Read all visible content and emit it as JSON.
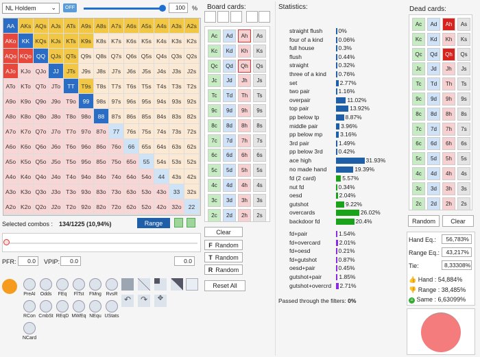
{
  "top": {
    "game": "NL Holdem",
    "toggle": "OFF",
    "percent": "100",
    "percent_unit": "%"
  },
  "range_grid": [
    [
      "AA",
      "AKs",
      "AQs",
      "AJs",
      "ATs",
      "A9s",
      "A8s",
      "A7s",
      "A6s",
      "A5s",
      "A4s",
      "A3s",
      "A2s"
    ],
    [
      "AKo",
      "KK",
      "KQs",
      "KJs",
      "KTs",
      "K9s",
      "K8s",
      "K7s",
      "K6s",
      "K5s",
      "K4s",
      "K3s",
      "K2s"
    ],
    [
      "AQo",
      "KQo",
      "QQ",
      "QJs",
      "QTs",
      "Q9s",
      "Q8s",
      "Q7s",
      "Q6s",
      "Q5s",
      "Q4s",
      "Q3s",
      "Q2s"
    ],
    [
      "AJo",
      "KJo",
      "QJo",
      "JJ",
      "JTs",
      "J9s",
      "J8s",
      "J7s",
      "J6s",
      "J5s",
      "J4s",
      "J3s",
      "J2s"
    ],
    [
      "ATo",
      "KTo",
      "QTo",
      "JTo",
      "TT",
      "T9s",
      "T8s",
      "T7s",
      "T6s",
      "T5s",
      "T4s",
      "T3s",
      "T2s"
    ],
    [
      "A9o",
      "K9o",
      "Q9o",
      "J9o",
      "T9o",
      "99",
      "98s",
      "97s",
      "96s",
      "95s",
      "94s",
      "93s",
      "92s"
    ],
    [
      "A8o",
      "K8o",
      "Q8o",
      "J8o",
      "T8o",
      "98o",
      "88",
      "87s",
      "86s",
      "85s",
      "84s",
      "83s",
      "82s"
    ],
    [
      "A7o",
      "K7o",
      "Q7o",
      "J7o",
      "T7o",
      "97o",
      "87o",
      "77",
      "76s",
      "75s",
      "74s",
      "73s",
      "72s"
    ],
    [
      "A6o",
      "K6o",
      "Q6o",
      "J6o",
      "T6o",
      "96o",
      "86o",
      "76o",
      "66",
      "65s",
      "64s",
      "63s",
      "62s"
    ],
    [
      "A5o",
      "K5o",
      "Q5o",
      "J5o",
      "T5o",
      "95o",
      "85o",
      "75o",
      "65o",
      "55",
      "54s",
      "53s",
      "52s"
    ],
    [
      "A4o",
      "K4o",
      "Q4o",
      "J4o",
      "T4o",
      "94o",
      "84o",
      "74o",
      "64o",
      "54o",
      "44",
      "43s",
      "42s"
    ],
    [
      "A3o",
      "K3o",
      "Q3o",
      "J3o",
      "T3o",
      "93o",
      "83o",
      "73o",
      "63o",
      "53o",
      "43o",
      "33",
      "32s"
    ],
    [
      "A2o",
      "K2o",
      "Q2o",
      "J2o",
      "T2o",
      "92o",
      "82o",
      "72o",
      "62o",
      "52o",
      "42o",
      "32o",
      "22"
    ]
  ],
  "selection": {
    "label": "Selected combos :",
    "value": "134/1225 (10,94%)",
    "range_button": "Range"
  },
  "pfr": {
    "label": "PFR:",
    "value": "0.0",
    "vpip_label": "VPIP:",
    "vpip_value": "0.0",
    "extra": "0.0"
  },
  "tools": [
    "PreAI",
    "Odds",
    "FEq",
    "FlTst",
    "FMng",
    "RvsR",
    "RCon",
    "CmbSt",
    "REqD",
    "MWEq",
    "NEqu",
    "UStats",
    "NCard"
  ],
  "board": {
    "title": "Board cards:",
    "clear": "Clear",
    "random_f": "Random",
    "random_t": "Random",
    "random_r": "Random",
    "reset": "Reset All",
    "rows": [
      [
        "Ac",
        "Ad",
        "Ah",
        "As"
      ],
      [
        "Kc",
        "Kd",
        "Kh",
        "Ks"
      ],
      [
        "Qc",
        "Qd",
        "Qh",
        "Qs"
      ],
      [
        "Jc",
        "Jd",
        "Jh",
        "Js"
      ],
      [
        "Tc",
        "Td",
        "Th",
        "Ts"
      ],
      [
        "9c",
        "9d",
        "9h",
        "9s"
      ],
      [
        "8c",
        "8d",
        "8h",
        "8s"
      ],
      [
        "7c",
        "7d",
        "7h",
        "7s"
      ],
      [
        "6c",
        "6d",
        "6h",
        "6s"
      ],
      [
        "5c",
        "5d",
        "5h",
        "5s"
      ],
      [
        "4c",
        "4d",
        "4h",
        "4s"
      ],
      [
        "3c",
        "3d",
        "3h",
        "3s"
      ],
      [
        "2c",
        "2d",
        "2h",
        "2s"
      ]
    ]
  },
  "stats": {
    "title": "Statistics:",
    "passed": "Passed through the filters:",
    "passed_value": "0%",
    "groups": [
      [
        [
          "straight flush",
          "0%",
          0
        ],
        [
          "four of a kind",
          "0.06%",
          0.06
        ],
        [
          "full house",
          "0.3%",
          0.3
        ],
        [
          "flush",
          "0.44%",
          0.44
        ],
        [
          "straight",
          "0.32%",
          0.32
        ],
        [
          "three of a kind",
          "0.76%",
          0.76
        ],
        [
          "set",
          "2.77%",
          2.77
        ],
        [
          "two pair",
          "1.16%",
          1.16
        ],
        [
          "overpair",
          "11.02%",
          11.02
        ],
        [
          "top pair",
          "13.92%",
          13.92
        ],
        [
          "pp below tp",
          "8.87%",
          8.87
        ],
        [
          "middle pair",
          "3.96%",
          3.96
        ],
        [
          "pp below mp",
          "3.16%",
          3.16
        ],
        [
          "3rd pair",
          "1.49%",
          1.49
        ],
        [
          "pp below 3rd",
          "0.42%",
          0.42
        ],
        [
          "ace high",
          "31.93%",
          31.93
        ],
        [
          "no made hand",
          "19.39%",
          19.39
        ]
      ],
      [
        [
          "fd (2 card)",
          "5.57%",
          5.57
        ],
        [
          "nut fd",
          "0.34%",
          0.34
        ],
        [
          "oesd",
          "2.04%",
          2.04
        ],
        [
          "gutshot",
          "9.22%",
          9.22
        ],
        [
          "overcards",
          "26.02%",
          26.02
        ],
        [
          "backdoor fd",
          "20.4%",
          20.4
        ]
      ],
      [
        [
          "fd+pair",
          "1.54%",
          1.54
        ],
        [
          "fd+overcard",
          "2.01%",
          2.01
        ],
        [
          "fd+oesd",
          "0.21%",
          0.21
        ],
        [
          "fd+gutshot",
          "0.87%",
          0.87
        ],
        [
          "oesd+pair",
          "0.45%",
          0.45
        ],
        [
          "gutshot+pair",
          "1.85%",
          1.85
        ],
        [
          "gutshot+overcrd",
          "2.71%",
          2.71
        ]
      ]
    ]
  },
  "dead": {
    "title": "Dead cards:",
    "random": "Random",
    "clear": "Clear"
  },
  "equity": {
    "hand_label": "Hand Eq.:",
    "hand": "56,783%",
    "range_label": "Range Eq.:",
    "range": "43,217%",
    "tie_label": "Tie:",
    "tie": "8,33308%",
    "hand_pct_label": "Hand :",
    "hand_pct": "54,884%",
    "range_pct_label": "Range :",
    "range_pct": "38,485%",
    "same_label": "Same :",
    "same": "6,63099%"
  },
  "colors": {
    "blue": "#1f5fa8",
    "green": "#1aa31a",
    "purple": "#8a2be2",
    "pie": "#f47c7c"
  }
}
